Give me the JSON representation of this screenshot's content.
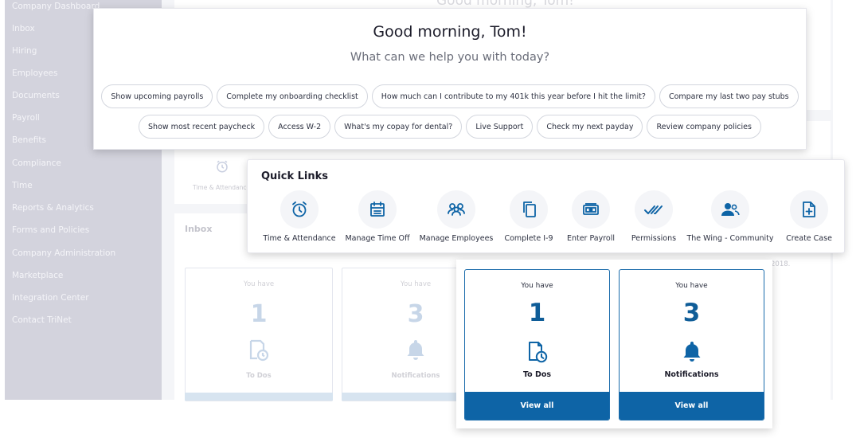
{
  "sidebar": {
    "items": [
      {
        "label": "Company Dashboard"
      },
      {
        "label": "Inbox"
      },
      {
        "label": "Hiring"
      },
      {
        "label": "Employees"
      },
      {
        "label": "Documents"
      },
      {
        "label": "Payroll"
      },
      {
        "label": "Benefits"
      },
      {
        "label": "Compliance"
      },
      {
        "label": "Time"
      },
      {
        "label": "Reports & Analytics"
      },
      {
        "label": "Forms and Policies"
      },
      {
        "label": "Company Administration"
      },
      {
        "label": "Marketplace"
      },
      {
        "label": "Integration Center"
      },
      {
        "label": "Contact TriNet"
      }
    ]
  },
  "background": {
    "title": "Good morning, Tom!",
    "quick_link_label": "Time & Attendance",
    "inbox_heading": "Inbox",
    "ghost_text": "2018.",
    "tiles": [
      {
        "you_have": "You have",
        "count": "1",
        "label": "To Dos"
      },
      {
        "you_have": "You have",
        "count": "3",
        "label": "Notifications"
      }
    ]
  },
  "greeting": {
    "title": "Good morning, Tom!",
    "subtitle": "What can we help you with today?",
    "chips_row1": [
      {
        "label": "Show upcoming payrolls"
      },
      {
        "label": "Complete my onboarding checklist"
      },
      {
        "label": "How much can I contribute to my 401k this year before I hit the limit?"
      },
      {
        "label": "Compare my last two pay stubs"
      }
    ],
    "chips_row2": [
      {
        "label": "Show most recent paycheck"
      },
      {
        "label": "Access W-2"
      },
      {
        "label": "What's my copay for dental?"
      },
      {
        "label": "Live Support"
      },
      {
        "label": "Check my next payday"
      },
      {
        "label": "Review company policies"
      }
    ]
  },
  "quick_links": {
    "title": "Quick Links",
    "items": [
      {
        "label": "Time & Attendance",
        "icon": "alarm-clock-icon"
      },
      {
        "label": "Manage Time Off",
        "icon": "calendar-icon"
      },
      {
        "label": "Manage Employees",
        "icon": "people-group-icon"
      },
      {
        "label": "Complete I-9",
        "icon": "copy-documents-icon"
      },
      {
        "label": "Enter Payroll",
        "icon": "money-bill-icon"
      },
      {
        "label": "Permissions",
        "icon": "double-check-icon"
      },
      {
        "label": "The Wing - Community",
        "icon": "community-icon"
      },
      {
        "label": "Create Case",
        "icon": "new-document-icon"
      }
    ]
  },
  "inbox_tiles": [
    {
      "you_have": "You have",
      "count": "1",
      "label": "To Dos",
      "icon": "todo-document-clock-icon",
      "action": "View all"
    },
    {
      "you_have": "You have",
      "count": "3",
      "label": "Notifications",
      "icon": "bell-icon",
      "action": "View all"
    }
  ],
  "colors": {
    "brand_blue": "#0e64a6",
    "sidebar_bg": "#d3d3dd",
    "text_dark": "#1c1c2a",
    "text_muted": "#6b6e7a"
  }
}
